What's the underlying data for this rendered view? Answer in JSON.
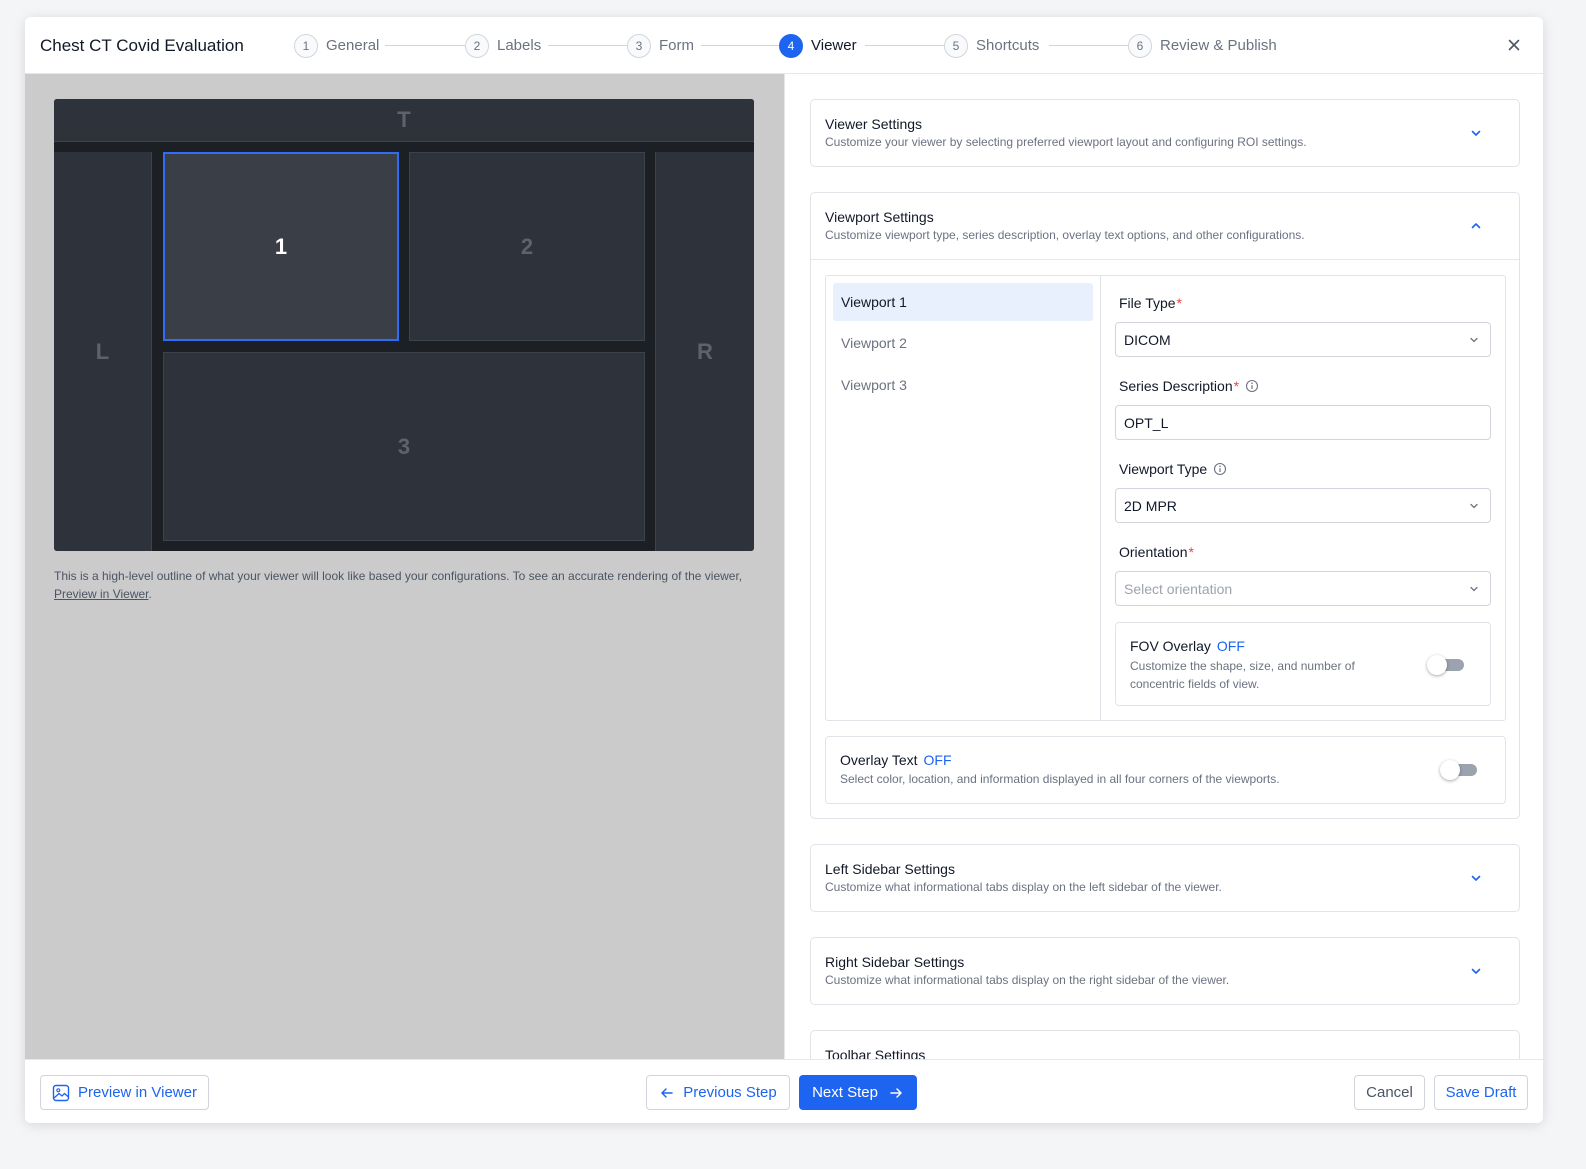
{
  "header": {
    "title": "Chest CT Covid Evaluation",
    "steps": [
      {
        "num": "1",
        "label": "General"
      },
      {
        "num": "2",
        "label": "Labels"
      },
      {
        "num": "3",
        "label": "Form"
      },
      {
        "num": "4",
        "label": "Viewer"
      },
      {
        "num": "5",
        "label": "Shortcuts"
      },
      {
        "num": "6",
        "label": "Review & Publish"
      }
    ],
    "active_step": 4,
    "close_icon": "close-icon"
  },
  "preview": {
    "top": "T",
    "left": "L",
    "right": "R",
    "vp1": "1",
    "vp2": "2",
    "vp3": "3",
    "note_text": "This is a high-level outline of what your viewer will look like based your configurations. To see an accurate rendering of the viewer,",
    "note_link": "Preview in Viewer",
    "note_end": "."
  },
  "viewer_settings": {
    "title": "Viewer Settings",
    "desc": "Customize your viewer by selecting preferred viewport layout and configuring ROI settings."
  },
  "viewport_settings": {
    "title": "Viewport Settings",
    "desc": "Customize viewport type, series description, overlay text options, and other configurations.",
    "viewports": [
      "Viewport 1",
      "Viewport 2",
      "Viewport 3"
    ],
    "file_type": {
      "label": "File Type",
      "required": "*",
      "value": "DICOM"
    },
    "series_description": {
      "label": "Series Description",
      "required": "*",
      "value": "OPT_L"
    },
    "viewport_type": {
      "label": "Viewport Type",
      "value": "2D MPR"
    },
    "orientation": {
      "label": "Orientation",
      "required": "*",
      "placeholder": "Select orientation"
    },
    "fov_overlay": {
      "label": "FOV Overlay",
      "state": "OFF",
      "desc_1": "Customize the shape, size, and number of",
      "desc_2": "concentric fields of view."
    },
    "overlay_text": {
      "label": "Overlay Text",
      "state": "OFF",
      "desc": "Select color, location, and information displayed in all four corners of the viewports."
    }
  },
  "left_sidebar_settings": {
    "title": "Left Sidebar Settings",
    "desc": "Customize what informational tabs display on the left sidebar of the viewer."
  },
  "right_sidebar_settings": {
    "title": "Right Sidebar Settings",
    "desc": "Customize what informational tabs display on the right sidebar of the viewer."
  },
  "toolbar_settings": {
    "title": "Toolbar Settings"
  },
  "footer": {
    "preview_button": "Preview in Viewer",
    "previous_button": "Previous Step",
    "next_button": "Next Step",
    "cancel_button": "Cancel",
    "save_button": "Save Draft"
  },
  "colors": {
    "accent": "#1d64f0",
    "required": "#ef4444"
  }
}
